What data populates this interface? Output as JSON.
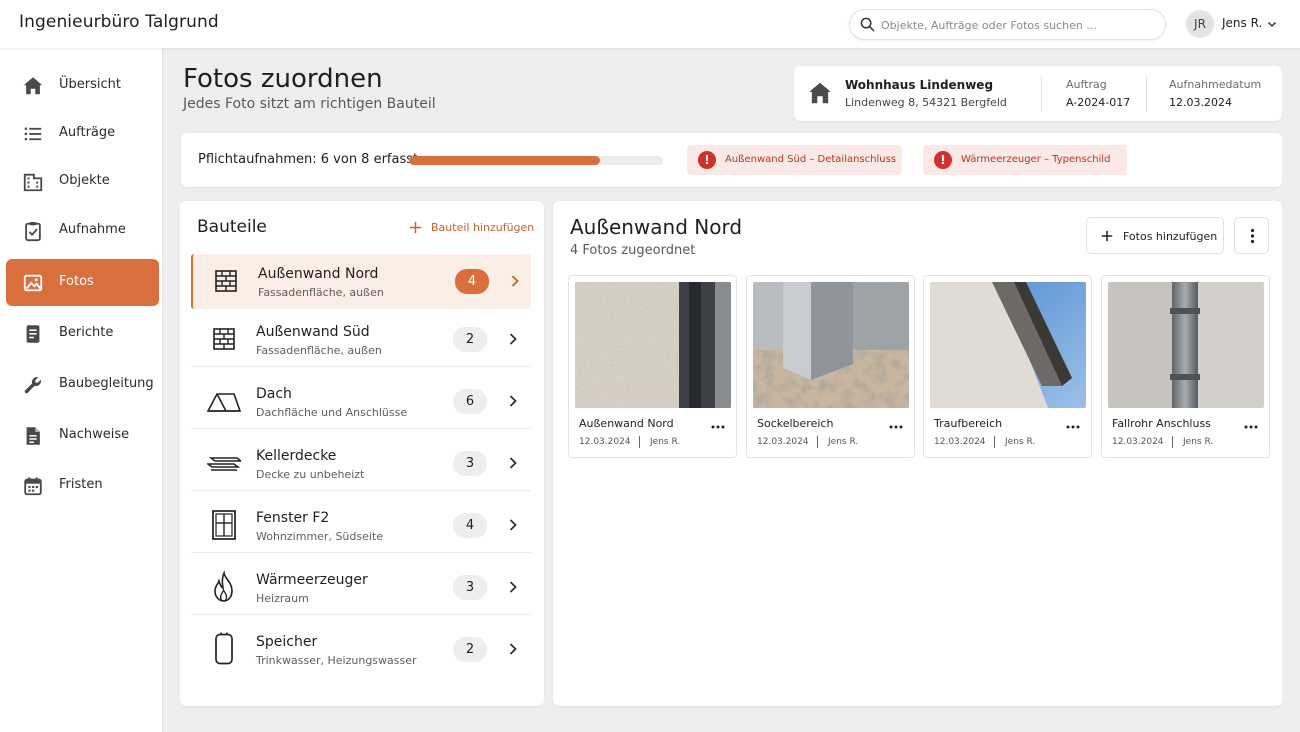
{
  "app": {
    "title": "Ingenieurbüro Talgrund"
  },
  "search": {
    "placeholder": "Objekte, Aufträge oder Fotos suchen ...",
    "icon": "search-icon"
  },
  "user": {
    "initials": "JR",
    "name": "Jens R."
  },
  "sidebar": {
    "items": [
      {
        "label": "Übersicht",
        "icon": "home-icon",
        "active": false
      },
      {
        "label": "Aufträge",
        "icon": "list-icon",
        "active": false
      },
      {
        "label": "Objekte",
        "icon": "building-icon",
        "active": false
      },
      {
        "label": "Aufnahme",
        "icon": "clipboard-check-icon",
        "active": false
      },
      {
        "label": "Fotos",
        "icon": "image-icon",
        "active": true
      },
      {
        "label": "Berichte",
        "icon": "report-icon",
        "active": false
      },
      {
        "label": "Baubegleitung",
        "icon": "wrench-icon",
        "active": false
      },
      {
        "label": "Nachweise",
        "icon": "document-icon",
        "active": false
      },
      {
        "label": "Fristen",
        "icon": "calendar-icon",
        "active": false
      }
    ]
  },
  "page": {
    "title": "Fotos zuordnen",
    "subtitle": "Jedes Foto sitzt am richtigen Bauteil"
  },
  "project": {
    "name": "Wohnhaus Lindenweg",
    "address": "Lindenweg 8, 54321 Bergfeld",
    "order_label": "Auftrag",
    "order_value": "A-2024-017",
    "date_label": "Aufnahmedatum",
    "date_value": "12.03.2024"
  },
  "progress": {
    "label": "Pflichtaufnahmen: 6 von 8 erfasst",
    "done": 6,
    "total": 8,
    "alerts": [
      {
        "text": "Außenwand Süd – Detailanschluss"
      },
      {
        "text": "Wärmeerzeuger – Typenschild"
      }
    ]
  },
  "parts": {
    "title": "Bauteile",
    "add_label": "Bauteil hinzufügen",
    "items": [
      {
        "name": "Außenwand Nord",
        "desc": "Fassadenfläche, außen",
        "count": "4",
        "icon": "wall-icon",
        "active": true
      },
      {
        "name": "Außenwand Süd",
        "desc": "Fassadenfläche, außen",
        "count": "2",
        "icon": "wall-icon",
        "active": false
      },
      {
        "name": "Dach",
        "desc": "Dachfläche und Anschlüsse",
        "count": "6",
        "icon": "roof-icon",
        "active": false
      },
      {
        "name": "Kellerdecke",
        "desc": "Decke zu unbeheizt",
        "count": "3",
        "icon": "slab-icon",
        "active": false
      },
      {
        "name": "Fenster F2",
        "desc": "Wohnzimmer, Südseite",
        "count": "4",
        "icon": "window-icon",
        "active": false
      },
      {
        "name": "Wärmeerzeuger",
        "desc": "Heizraum",
        "count": "3",
        "icon": "flame-icon",
        "active": false
      },
      {
        "name": "Speicher",
        "desc": "Trinkwasser, Heizungswasser",
        "count": "2",
        "icon": "tank-icon",
        "active": false
      }
    ]
  },
  "detail": {
    "title": "Außenwand Nord",
    "subtitle": "4 Fotos zugeordnet",
    "add_photos_label": "Fotos hinzufügen",
    "photos": [
      {
        "title": "Außenwand Nord",
        "date": "12.03.2024",
        "author": "Jens R."
      },
      {
        "title": "Sockelbereich",
        "date": "12.03.2024",
        "author": "Jens R."
      },
      {
        "title": "Traufbereich",
        "date": "12.03.2024",
        "author": "Jens R."
      },
      {
        "title": "Fallrohr Anschluss",
        "date": "12.03.2024",
        "author": "Jens R."
      }
    ]
  },
  "colors": {
    "accent": "#d86f3c",
    "alert_bg": "#fbe9e7",
    "alert_icon": "#d0322a"
  }
}
